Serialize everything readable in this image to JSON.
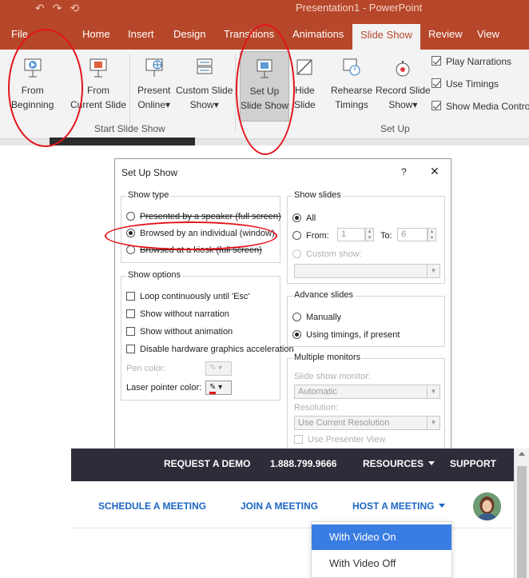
{
  "ppt": {
    "window_title": "Presentation1 - PowerPoint",
    "tabs": [
      "File",
      "Home",
      "Insert",
      "Design",
      "Transitions",
      "Animations",
      "Slide Show",
      "Review",
      "View"
    ],
    "ribbon": {
      "from_beginning": [
        "From",
        "Beginning"
      ],
      "from_current": [
        "From",
        "Current Slide"
      ],
      "present_online": [
        "Present",
        "Online"
      ],
      "custom_show": [
        "Custom Slide",
        "Show"
      ],
      "set_up": [
        "Set Up",
        "Slide Show"
      ],
      "hide_slide": [
        "Hide",
        "Slide"
      ],
      "rehearse": [
        "Rehearse",
        "Timings"
      ],
      "record": [
        "Record Slide",
        "Show"
      ],
      "dropdown_caret": "▾",
      "group_start": "Start Slide Show",
      "group_setup": "Set Up",
      "play_narrations": "Play Narrations",
      "use_timings": "Use Timings",
      "show_media": "Show Media Controls"
    }
  },
  "dialog": {
    "title": "Set Up Show",
    "help": "?",
    "close": "✕",
    "show_type": {
      "legend": "Show type",
      "speaker": "Presented by a speaker (full screen)",
      "individual": "Browsed by an individual (window)",
      "kiosk": "Browsed at a kiosk (full screen)"
    },
    "show_options": {
      "legend": "Show options",
      "loop": "Loop continuously until 'Esc'",
      "no_narration": "Show without narration",
      "no_animation": "Show without animation",
      "disable_hw": "Disable hardware graphics acceleration",
      "pen_color": "Pen color:",
      "laser_color": "Laser pointer color:"
    },
    "show_slides": {
      "legend": "Show slides",
      "all": "All",
      "from": "From:",
      "from_value": "1",
      "to": "To:",
      "to_value": "6",
      "custom": "Custom show:"
    },
    "advance": {
      "legend": "Advance slides",
      "manually": "Manually",
      "timings": "Using timings, if present"
    },
    "monitors": {
      "legend": "Multiple monitors",
      "monitor_label": "Slide show monitor:",
      "monitor_value": "Automatic",
      "resolution_label": "Resolution:",
      "resolution_value": "Use Current Resolution",
      "presenter_view": "Use Presenter View"
    }
  },
  "zoom": {
    "top": {
      "demo": "REQUEST A DEMO",
      "phone": "1.888.799.9666",
      "resources": "RESOURCES",
      "support": "SUPPORT"
    },
    "nav": {
      "schedule": "SCHEDULE A MEETING",
      "join": "JOIN A MEETING",
      "host": "HOST A MEETING"
    },
    "menu": {
      "video_on": "With Video On",
      "video_off": "With Video Off"
    }
  },
  "colors": {
    "ppt_red": "#b7472a",
    "annotation_red": "#e3131b",
    "zoom_dark": "#2d2d3a",
    "zoom_blue": "#1c66c4",
    "menu_highlight": "#3a7de2"
  }
}
